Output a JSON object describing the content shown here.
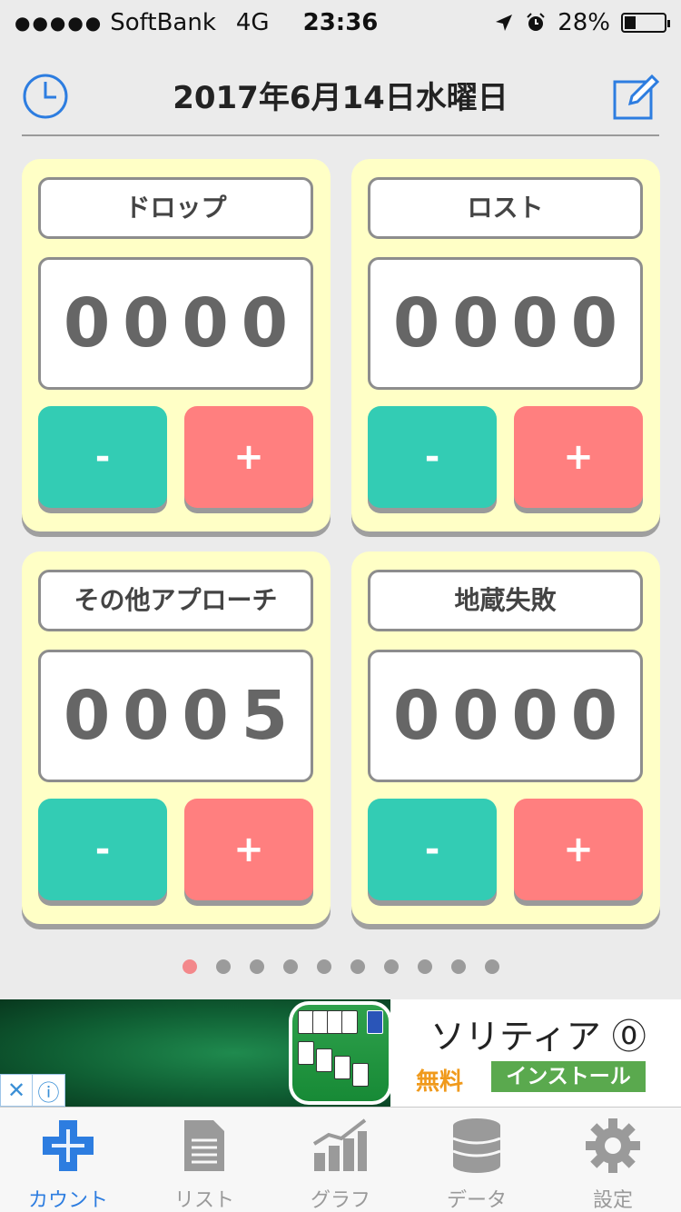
{
  "status_bar": {
    "signal_dots": "●●●●●",
    "carrier": "SoftBank",
    "network": "4G",
    "time": "23:36",
    "battery": "28%",
    "battery_fill": 0.28
  },
  "header": {
    "title": "2017年6月14日水曜日",
    "left_icon": "clock-icon",
    "right_icon": "edit-icon",
    "accent_color": "#2d7de0"
  },
  "counters": [
    {
      "name": "ドロップ",
      "digits": [
        "0",
        "0",
        "0",
        "0"
      ],
      "minus_label": "-",
      "plus_label": "+"
    },
    {
      "name": "ロスト",
      "digits": [
        "0",
        "0",
        "0",
        "0"
      ],
      "minus_label": "-",
      "plus_label": "+"
    },
    {
      "name": "その他アプローチ",
      "digits": [
        "0",
        "0",
        "0",
        "5"
      ],
      "minus_label": "-",
      "plus_label": "+"
    },
    {
      "name": "地蔵失敗",
      "digits": [
        "0",
        "0",
        "0",
        "0"
      ],
      "minus_label": "-",
      "plus_label": "+"
    }
  ],
  "colors": {
    "card_bg": "#ffffc6",
    "minus": "#33ccb4",
    "plus": "#ff7f7f",
    "active_dot": "#f3888b"
  },
  "pager": {
    "total": 10,
    "active_index": 0
  },
  "ad": {
    "app_name": "ソリティア ⓪",
    "price": "無料",
    "install_label": "インストール",
    "close_icon": "✕",
    "info_icon": "ⓘ"
  },
  "tabs": [
    {
      "label": "カウント",
      "icon": "plus-cross-icon",
      "active": true
    },
    {
      "label": "リスト",
      "icon": "document-icon",
      "active": false
    },
    {
      "label": "グラフ",
      "icon": "chart-icon",
      "active": false
    },
    {
      "label": "データ",
      "icon": "database-icon",
      "active": false
    },
    {
      "label": "設定",
      "icon": "gear-icon",
      "active": false
    }
  ]
}
